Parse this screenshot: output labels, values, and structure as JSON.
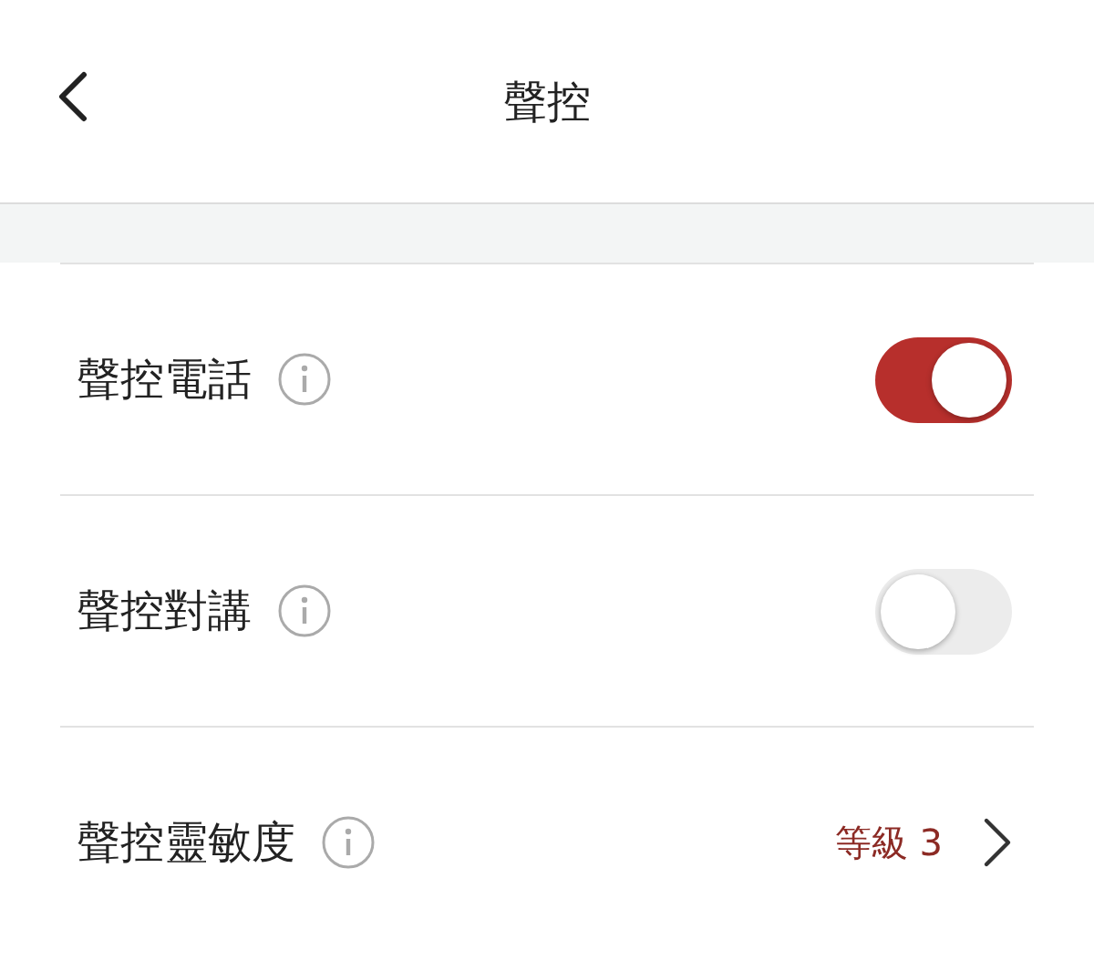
{
  "title": "聲控",
  "settings": [
    {
      "kind": "toggle",
      "label": "聲控電話",
      "on": true
    },
    {
      "kind": "toggle",
      "label": "聲控對講",
      "on": false
    },
    {
      "kind": "link",
      "label": "聲控靈敏度",
      "value": "等級 3"
    }
  ]
}
